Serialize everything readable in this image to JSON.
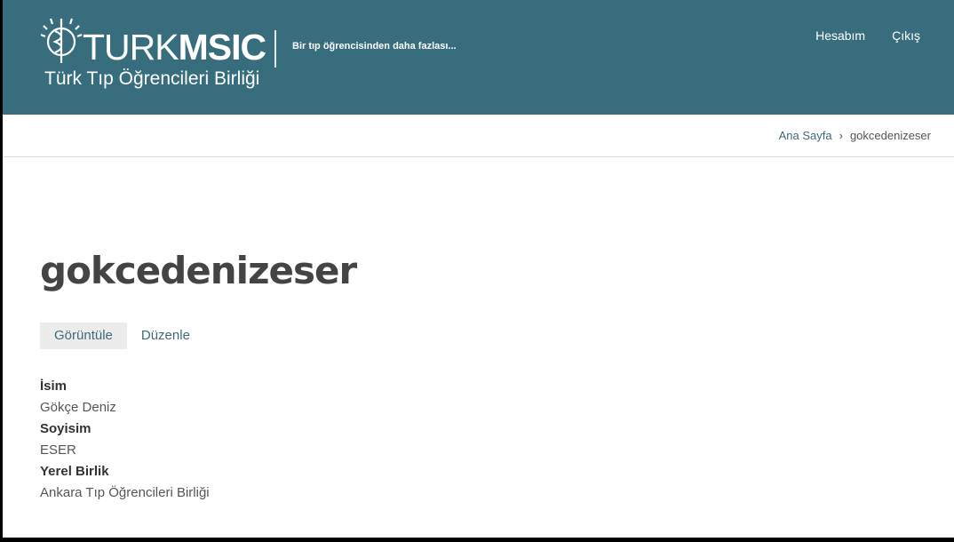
{
  "header": {
    "logo": {
      "text_thin": "TURK",
      "text_bold": "MSIC",
      "subtitle": "Türk Tıp Öğrencileri Birliği"
    },
    "slogan": "Bir tıp öğrencisinden daha fazlası...",
    "nav": {
      "account": "Hesabım",
      "logout": "Çıkış"
    },
    "background_color": "#386d7e"
  },
  "breadcrumb": {
    "home": "Ana Sayfa",
    "separator": "›",
    "current": "gokcedenizeser"
  },
  "page": {
    "title": "gokcedenizeser",
    "tabs": [
      {
        "label": "Görüntüle",
        "active": true
      },
      {
        "label": "Düzenle",
        "active": false
      }
    ],
    "fields": [
      {
        "label": "İsim",
        "value": "Gökçe Deniz"
      },
      {
        "label": "Soyisim",
        "value": "ESER"
      },
      {
        "label": "Yerel Birlik",
        "value": "Ankara Tıp Öğrencileri Birliği"
      }
    ]
  },
  "colors": {
    "link": "#3f6a78",
    "title": "#444444",
    "tab_active_bg": "#ececec"
  }
}
